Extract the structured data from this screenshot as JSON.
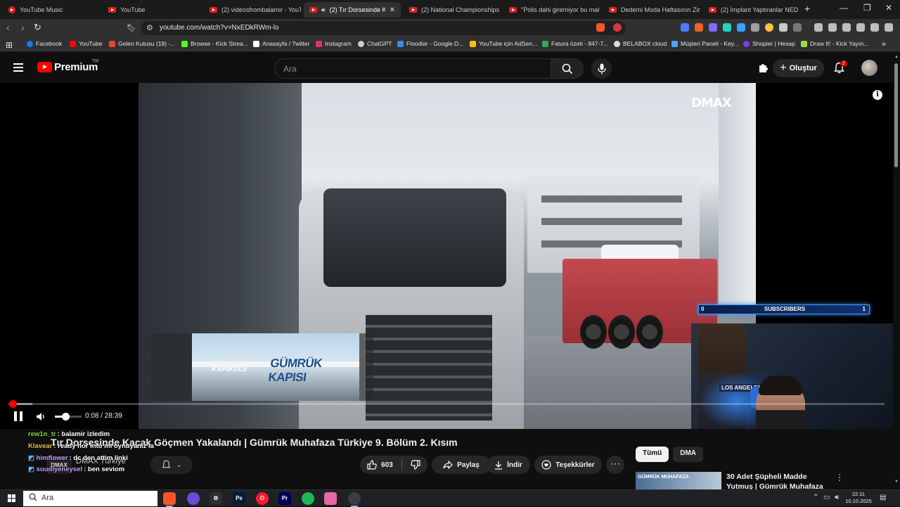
{
  "browser": {
    "tabs": [
      {
        "label": "YouTube Music",
        "icon": "youtube-music-icon"
      },
      {
        "label": "YouTube",
        "icon": "youtube-icon"
      },
      {
        "label": "(2) videosfrombalamir - YouTube",
        "icon": "youtube-icon"
      },
      {
        "label": "(2) Tır Dorsesinde Kaçak",
        "icon": "youtube-icon",
        "active": true
      },
      {
        "label": "(2) National Championships | S",
        "icon": "youtube-icon"
      },
      {
        "label": "\"Polis dahi giremiyor bu mahall",
        "icon": "youtube-icon"
      },
      {
        "label": "Dedemi Moda Haftasının Zirve",
        "icon": "youtube-icon"
      },
      {
        "label": "(2) İmplant Yaptıranlar NEDEN",
        "icon": "youtube-icon"
      }
    ],
    "url": "youtube.com/watch?v=NxEDkRWm-lo",
    "bookmarks": [
      {
        "label": "Facebook",
        "color": "#1877f2"
      },
      {
        "label": "YouTube",
        "color": "#ff0000"
      },
      {
        "label": "Gelen Kutusu (19) -...",
        "color": "#ea4335"
      },
      {
        "label": "Browse - Kick Strea...",
        "color": "#53fc18"
      },
      {
        "label": "Anasayfa / Twitter",
        "color": "#ffffff"
      },
      {
        "label": "Instagram",
        "color": "#e1306c"
      },
      {
        "label": "ChatGPT",
        "color": "#cccccc"
      },
      {
        "label": "Floodlar - Google D...",
        "color": "#4285f4"
      },
      {
        "label": "YouTube için AdSen...",
        "color": "#fbbc04"
      },
      {
        "label": "Fatura özeti - 847-7...",
        "color": "#34a853"
      },
      {
        "label": "BELABOX cloud",
        "color": "#dddddd"
      },
      {
        "label": "Müşteri Paneli - Key...",
        "color": "#4aa3ff"
      },
      {
        "label": "Shopier | Hesap",
        "color": "#7b3fe4"
      },
      {
        "label": "Draw It! - Kick Yayın...",
        "color": "#a0d84a"
      }
    ]
  },
  "youtube": {
    "logo_text": "Premium",
    "logo_region": "TR",
    "search_placeholder": "Ara",
    "create_label": "Oluştur",
    "notification_count": "2"
  },
  "player": {
    "brand_watermark": "DMAX",
    "lower_third_title": "GÜMRÜK KAPISI",
    "lower_third_sub": "KAPIKULE",
    "current_time": "0:08",
    "duration": "28:39",
    "time_display": "0:08 / 28:39",
    "progress_fraction": 0.0047,
    "buffered_fraction": 0.027,
    "volume_fraction": 0.4,
    "stream_overlay": {
      "subs_label": "SUBSCRIBERS",
      "subs_min": "0",
      "subs_max": "1",
      "webcam_sign": "LOS ANGELES"
    }
  },
  "video": {
    "title": "Tır Dorsesinde Kaçak Göçmen Yakalandı | Gümrük Muhafaza Türkiye 9. Bölüm 2. Kısım",
    "channel": "DMAX Türkiye",
    "channel_avatar_text": "DMAX",
    "likes": "603",
    "share_label": "Paylaş",
    "download_label": "İndir",
    "thanks_label": "Teşekkürler"
  },
  "chat": [
    {
      "user": "rew1n_tr",
      "text": ": balamir izledim",
      "color": "#7cd64a"
    },
    {
      "user": "Klavear",
      "text": ": ready nor into mi oynuyanız la",
      "color": "#e8c04a"
    },
    {
      "user": "himflower",
      "text": ": dc den attim linki",
      "color": "#c99bff"
    },
    {
      "user": "suudiyeneysel",
      "text": ": ben seviom",
      "color": "#c99bff"
    }
  ],
  "recommendations": {
    "chips": [
      {
        "label": "Tümü",
        "active": true
      },
      {
        "label": "DMA",
        "active": false
      }
    ],
    "first_title": "30 Adet Şüpheli Madde Yutmuş | Gümrük Muhafaza Türkiye 9.",
    "first_thumb_text": "GÜMRÜK MUHAFAZA"
  },
  "taskbar": {
    "search_placeholder": "Ara",
    "apps": [
      {
        "name": "brave-app-icon",
        "label": "",
        "color": "#fb542b"
      },
      {
        "name": "obs-app-icon",
        "label": "",
        "color": "#6e4ad9"
      },
      {
        "name": "settings-app-icon",
        "label": "⚙",
        "color": "#2d2f33"
      },
      {
        "name": "photoshop-app-icon",
        "label": "Ps",
        "color": "#001e36"
      },
      {
        "name": "opera-app-icon",
        "label": "O",
        "color": "#ff1b2d"
      },
      {
        "name": "premiere-app-icon",
        "label": "Pr",
        "color": "#00005b"
      },
      {
        "name": "spotify-app-icon",
        "label": "",
        "color": "#1db954"
      },
      {
        "name": "gallery-app-icon",
        "label": "",
        "color": "#e56aa8"
      },
      {
        "name": "chat-app-icon",
        "label": "",
        "color": "#3a3d42"
      }
    ],
    "time": "22:11",
    "date": "10.10.2025"
  }
}
